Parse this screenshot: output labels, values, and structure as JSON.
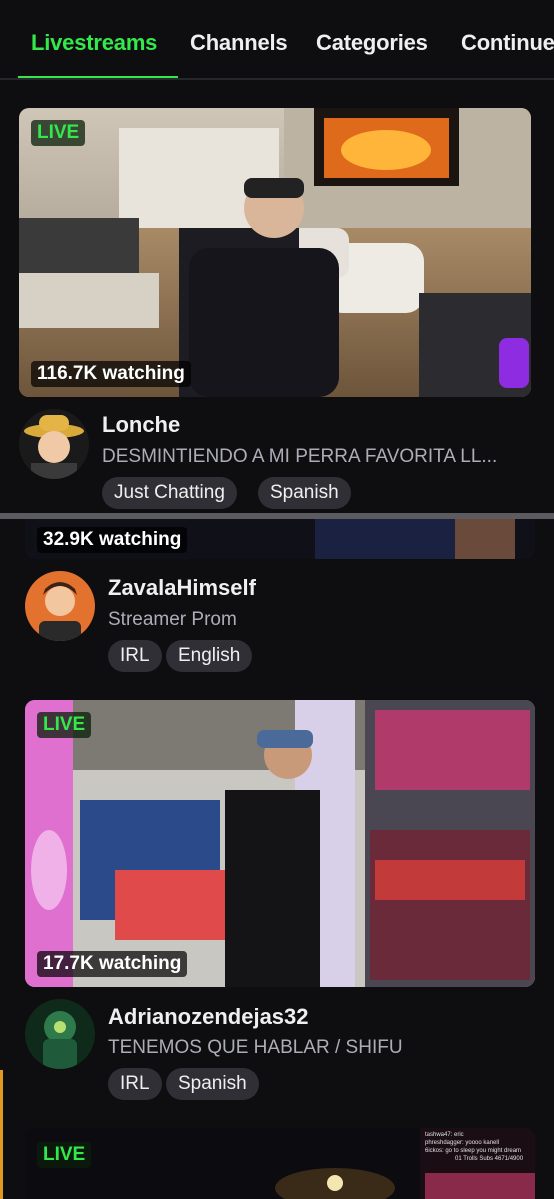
{
  "tabs": [
    {
      "label": "Livestreams",
      "active": true
    },
    {
      "label": "Channels",
      "active": false
    },
    {
      "label": "Categories",
      "active": false
    },
    {
      "label": "Continue",
      "active": false
    }
  ],
  "streams": [
    {
      "live_label": "LIVE",
      "viewers": "116.7K watching",
      "name": "Lonche",
      "title": "DESMINTIENDO A MI PERRA FAVORITA LL...",
      "tags": [
        "Just Chatting",
        "Spanish"
      ]
    },
    {
      "viewers": "32.9K watching",
      "name": "ZavalaHimself",
      "title": "Streamer Prom",
      "tags": [
        "IRL",
        "English"
      ]
    },
    {
      "live_label": "LIVE",
      "viewers": "17.7K watching",
      "name": "Adrianozendejas32",
      "title": "TENEMOS QUE HABLAR / SHIFU",
      "tags": [
        "IRL",
        "Spanish"
      ]
    },
    {
      "live_label": "LIVE"
    }
  ],
  "overlay_chat": [
    "tashwa47: eric",
    "phreshdagger: yoooo kanell",
    "6ickos: go to sleep you might dream",
    "01 Trolls Subs 4671/4900"
  ],
  "colors": {
    "accent": "#34e84b",
    "background": "#0e0e10",
    "tag_bg": "#2f2f35"
  }
}
